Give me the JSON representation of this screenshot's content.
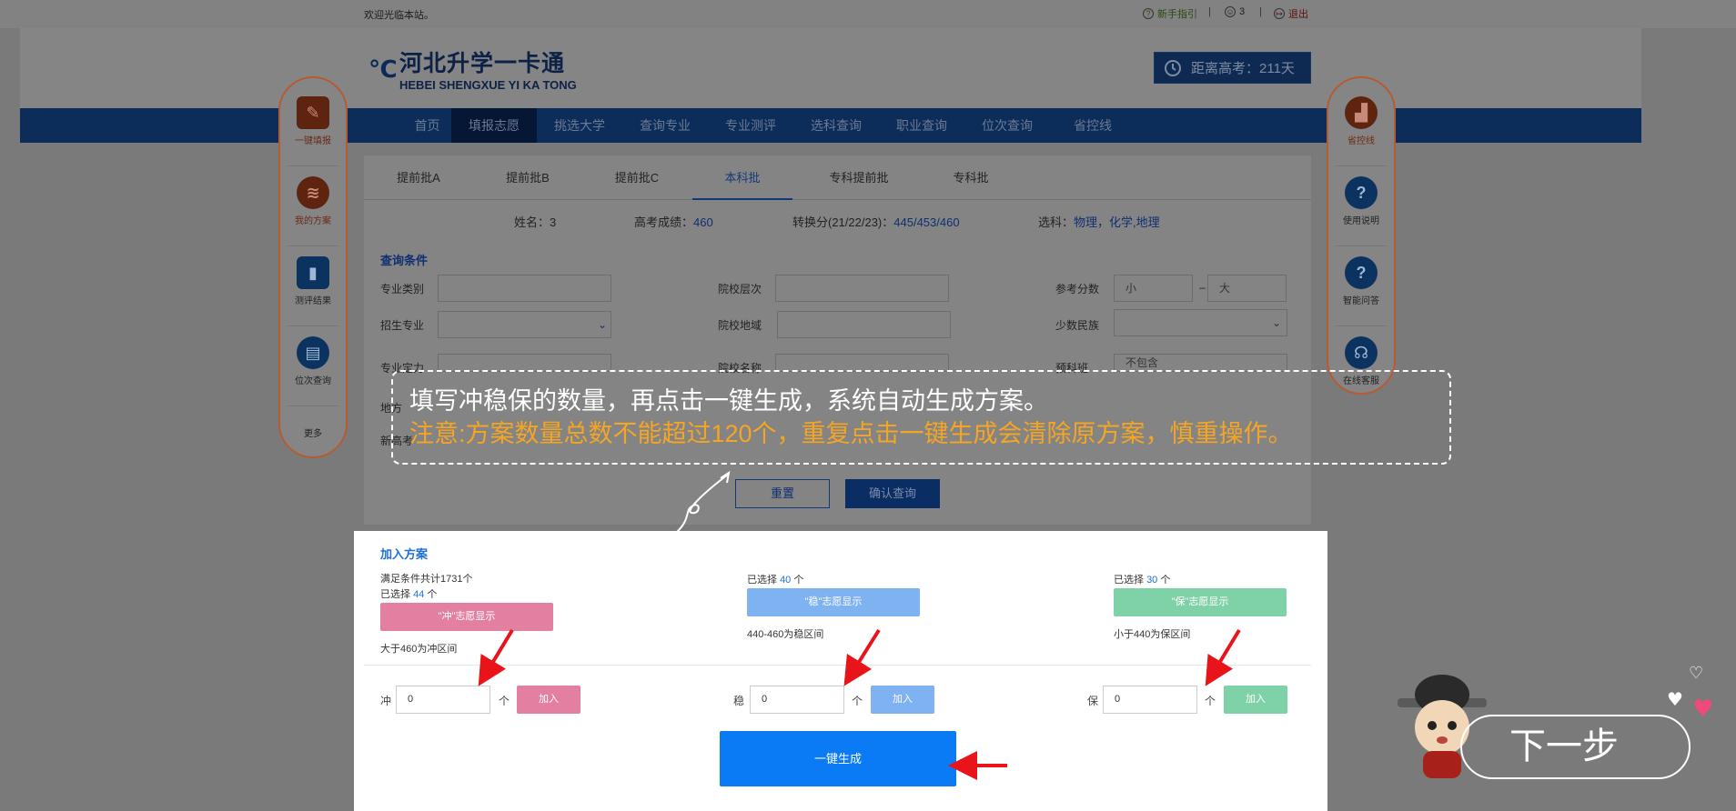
{
  "topbar": {
    "welcome": "欢迎光临本站。",
    "guide_label": "新手指引",
    "count": "3",
    "logout_label": "退出",
    "separator": "|"
  },
  "header": {
    "logo_cn": "河北升学一卡通",
    "logo_en": "HEBEI SHENGXUE YI KA TONG",
    "countdown": "距离高考：211天"
  },
  "nav": {
    "items": [
      "首页",
      "填报志愿",
      "挑选大学",
      "查询专业",
      "专业测评",
      "选科查询",
      "职业查询",
      "位次查询",
      "省控线"
    ],
    "active": "填报志愿"
  },
  "tabs": {
    "items": [
      "提前批A",
      "提前批B",
      "提前批C",
      "本科批",
      "专科提前批",
      "专科批"
    ],
    "active": "本科批"
  },
  "student": {
    "name_label": "姓名：",
    "name": "3",
    "score_label": "高考成绩：",
    "score": "460",
    "converted_label": "转换分(21/22/23)：",
    "converted": "445/453/460",
    "subjects_label": "选科：",
    "subjects": "物理，化学,地理"
  },
  "query": {
    "title": "查询条件",
    "major_type": "专业类别",
    "school_level": "院校层次",
    "ref_score": "参考分数",
    "min_placeholder": "小",
    "max_placeholder": "大",
    "range_sep": "–",
    "enroll_major": "招生专业",
    "school_region": "院校地域",
    "minority": "少数民族",
    "row3_label1": "专业定力",
    "row3_label2": "院校名称",
    "row3_label3": "预科班",
    "row3_value3": "不包含",
    "row4_label1": "地方",
    "row5_label1": "新高考",
    "reset": "重置",
    "confirm": "确认查询"
  },
  "side_left": {
    "items": [
      "一键填报",
      "我的方案",
      "测评结果",
      "位次查询"
    ],
    "more": "更多"
  },
  "side_right": {
    "items": [
      "省控线",
      "使用说明",
      "智能问答",
      "在线客服"
    ]
  },
  "plan": {
    "title": "加入方案",
    "total_prefix": "满足条件共计",
    "total": "1731",
    "unit": "个",
    "selected_prefix": "已选择",
    "chong": {
      "selected": "44",
      "button": "\"冲\"志愿显示",
      "range": "大于460为冲区间",
      "label": "冲",
      "value": "0",
      "add": "加入"
    },
    "wen": {
      "selected": "40",
      "button": "\"稳\"志愿显示",
      "range": "440-460为稳区间",
      "label": "稳",
      "value": "0",
      "add": "加入"
    },
    "bao": {
      "selected": "30",
      "button": "\"保\"志愿显示",
      "range": "小于440为保区间",
      "label": "保",
      "value": "0",
      "add": "加入"
    },
    "generate": "一键生成"
  },
  "tip": {
    "line1": "填写冲稳保的数量，再点击一键生成，系统自动生成方案。",
    "line2": "注意:方案数量总数不能超过120个，重复点击一键生成会清除原方案，慎重操作。"
  },
  "next_step": "下一步",
  "colors": {
    "chong": "#e37fa1",
    "wen": "#7fb2f0",
    "bao": "#7fd1a8",
    "primary": "#0a7af5",
    "arrow": "#e8141a",
    "tip_highlight": "#f5a524"
  }
}
